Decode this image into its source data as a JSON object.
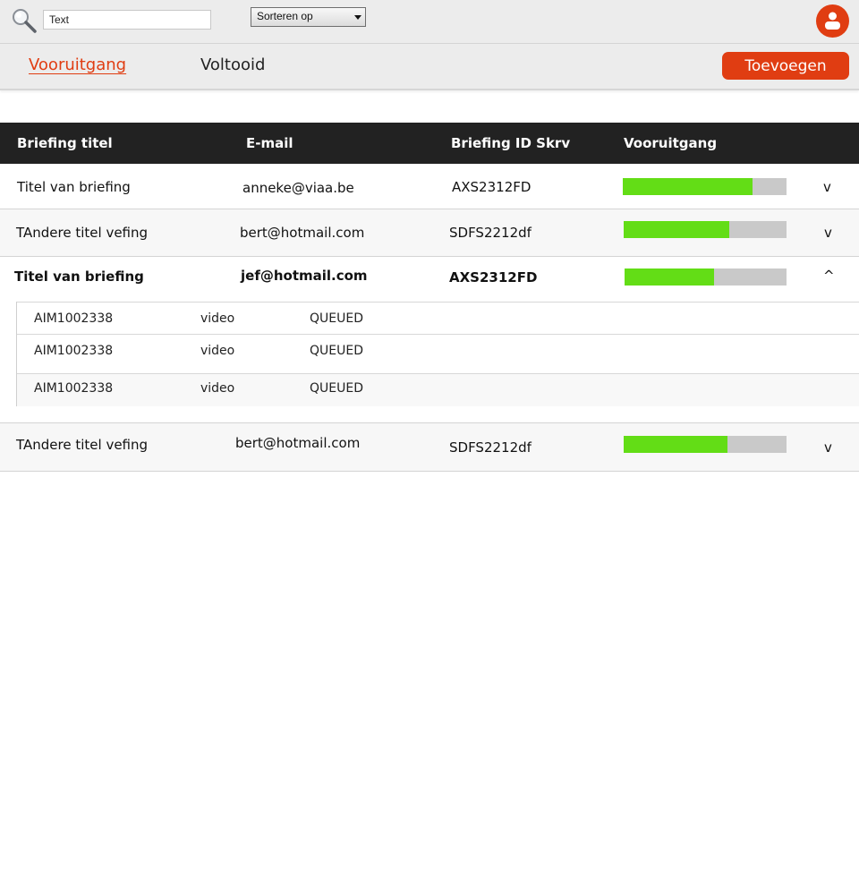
{
  "toolbar": {
    "search_value": "Text",
    "sort_label": "Sorteren op"
  },
  "tabs": [
    {
      "label": "Vooruitgang",
      "active": true
    },
    {
      "label": "Voltooid",
      "active": false
    }
  ],
  "add_button": "Toevoegen",
  "table": {
    "headers": [
      "Briefing titel",
      "E-mail",
      "Briefing ID Skrv",
      "Vooruitgang"
    ],
    "rows": [
      {
        "title": "Titel van briefing",
        "email": "anneke@viaa.be",
        "id": "AXS2312FD",
        "progress": 0.79,
        "toggle": "v"
      },
      {
        "title": "TAndere titel vefing",
        "email": "bert@hotmail.com",
        "id": "SDFS2212df",
        "progress": 0.65,
        "toggle": "v"
      },
      {
        "title": "Titel van briefing",
        "email": "jef@hotmail.com",
        "id": "AXS2312FD",
        "progress": 0.55,
        "toggle": "^",
        "expanded": true,
        "items": [
          {
            "code": "AIM1002338",
            "type": "video",
            "status": "QUEUED"
          },
          {
            "code": "AIM1002338",
            "type": "video",
            "status": "QUEUED"
          },
          {
            "code": "AIM1002338",
            "type": "video",
            "status": "QUEUED"
          }
        ]
      },
      {
        "title": "TAndere titel vefing",
        "email": "bert@hotmail.com",
        "id": "SDFS2212df",
        "progress": 0.64,
        "toggle": "v"
      }
    ]
  },
  "colors": {
    "accent": "#e03d12",
    "progress_fill": "#63dd16",
    "progress_track": "#c9c9c9",
    "header_bg": "#222222"
  }
}
